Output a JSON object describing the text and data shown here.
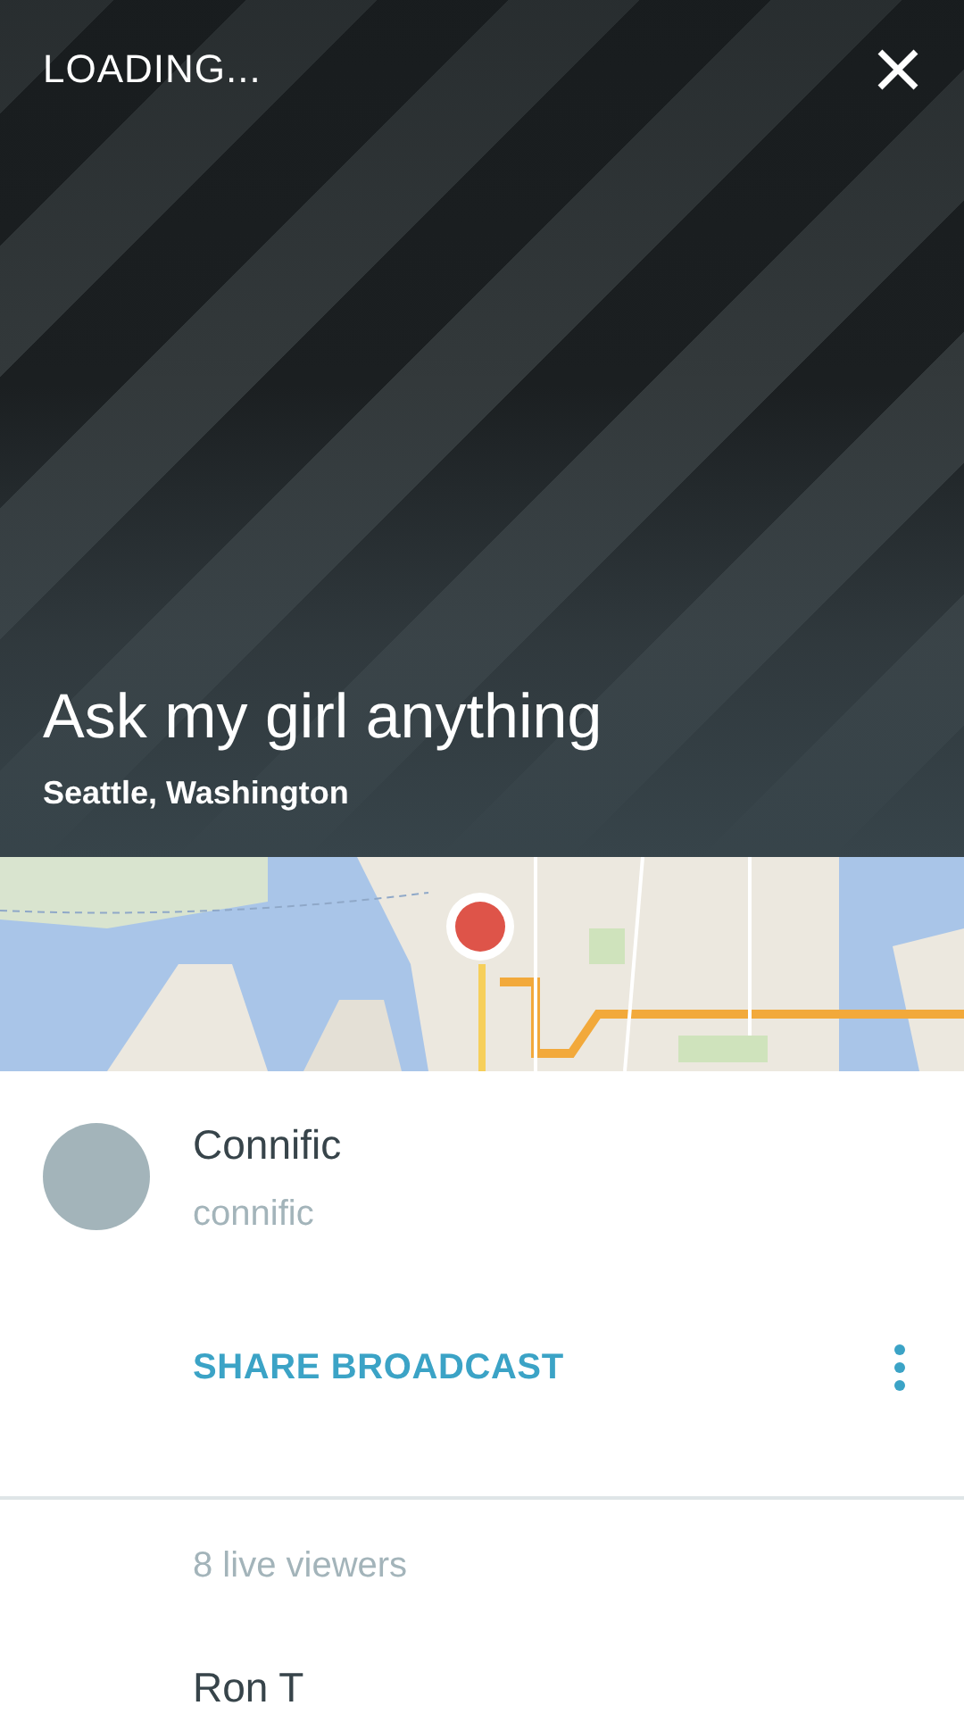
{
  "header": {
    "status": "LOADING...",
    "title": "Ask my girl anything",
    "location": "Seattle, Washington"
  },
  "broadcaster": {
    "name": "Connific",
    "handle": "connific"
  },
  "share": {
    "label": "SHARE BROADCAST"
  },
  "viewers": {
    "count": "8 live viewers",
    "list": [
      {
        "name": "Ron T"
      }
    ]
  }
}
